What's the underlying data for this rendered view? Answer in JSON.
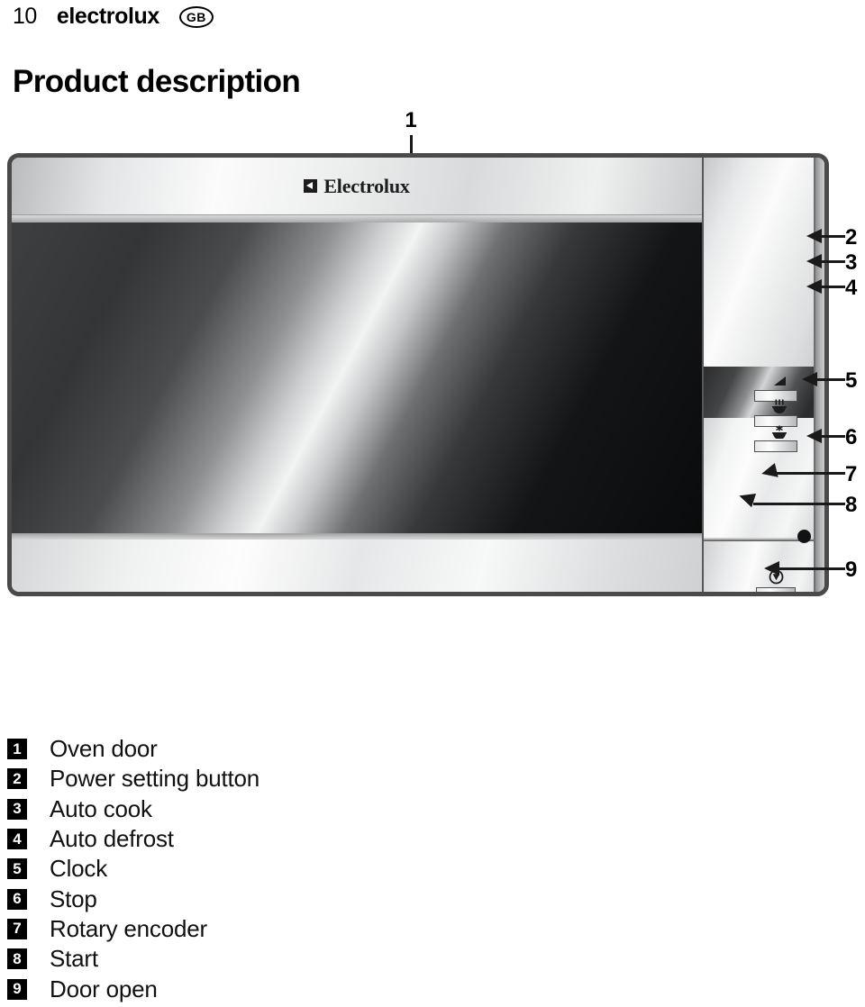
{
  "header": {
    "page_number": "10",
    "brand": "electrolux",
    "locale": "GB"
  },
  "title": "Product description",
  "figure": {
    "door_logo": "Electrolux",
    "callouts": [
      {
        "number": "1",
        "target": "oven-door"
      },
      {
        "number": "2",
        "target": "power-setting-button"
      },
      {
        "number": "3",
        "target": "auto-cook-button"
      },
      {
        "number": "4",
        "target": "auto-defrost-button"
      },
      {
        "number": "5",
        "target": "clock-button"
      },
      {
        "number": "6",
        "target": "stop-button"
      },
      {
        "number": "7",
        "target": "rotary-encoder"
      },
      {
        "number": "8",
        "target": "start-button"
      },
      {
        "number": "9",
        "target": "door-open-bar"
      }
    ],
    "icons": {
      "power": "power-level-wedge-icon",
      "auto_cook": "steaming-dish-icon",
      "auto_defrost": "defrost-snowflake-icon",
      "stop": "stop-circle-icon",
      "start": "start-power-icon",
      "quick_start": "plus-30-seconds-icon",
      "child_lock": "key-icon",
      "dial_marker": "triangle-marker-icon",
      "warning": "warning-triangle-icon"
    }
  },
  "legend": [
    {
      "number": "1",
      "label": "Oven door"
    },
    {
      "number": "2",
      "label": "Power setting button"
    },
    {
      "number": "3",
      "label": "Auto cook"
    },
    {
      "number": "4",
      "label": "Auto defrost"
    },
    {
      "number": "5",
      "label": "Clock"
    },
    {
      "number": "6",
      "label": "Stop"
    },
    {
      "number": "7",
      "label": "Rotary encoder"
    },
    {
      "number": "8",
      "label": "Start"
    },
    {
      "number": "9",
      "label": "Door open"
    }
  ]
}
